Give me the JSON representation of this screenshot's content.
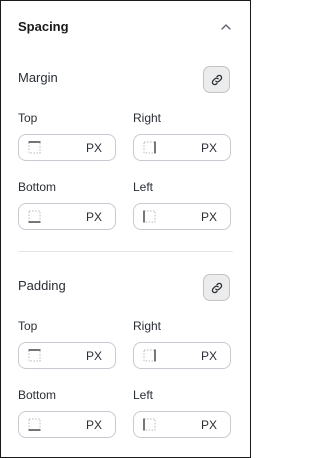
{
  "panel": {
    "title": "Spacing",
    "collapse_icon": "chevron-up-icon"
  },
  "margin": {
    "label": "Margin",
    "link_icon": "link-icon",
    "fields": [
      {
        "label": "Top",
        "unit": "PX",
        "icon": "side-top-icon"
      },
      {
        "label": "Right",
        "unit": "PX",
        "icon": "side-right-icon"
      },
      {
        "label": "Bottom",
        "unit": "PX",
        "icon": "side-bottom-icon"
      },
      {
        "label": "Left",
        "unit": "PX",
        "icon": "side-left-icon"
      }
    ]
  },
  "padding": {
    "label": "Padding",
    "link_icon": "link-icon",
    "fields": [
      {
        "label": "Top",
        "unit": "PX",
        "icon": "side-top-icon"
      },
      {
        "label": "Right",
        "unit": "PX",
        "icon": "side-right-icon"
      },
      {
        "label": "Bottom",
        "unit": "PX",
        "icon": "side-bottom-icon"
      },
      {
        "label": "Left",
        "unit": "PX",
        "icon": "side-left-icon"
      }
    ]
  }
}
